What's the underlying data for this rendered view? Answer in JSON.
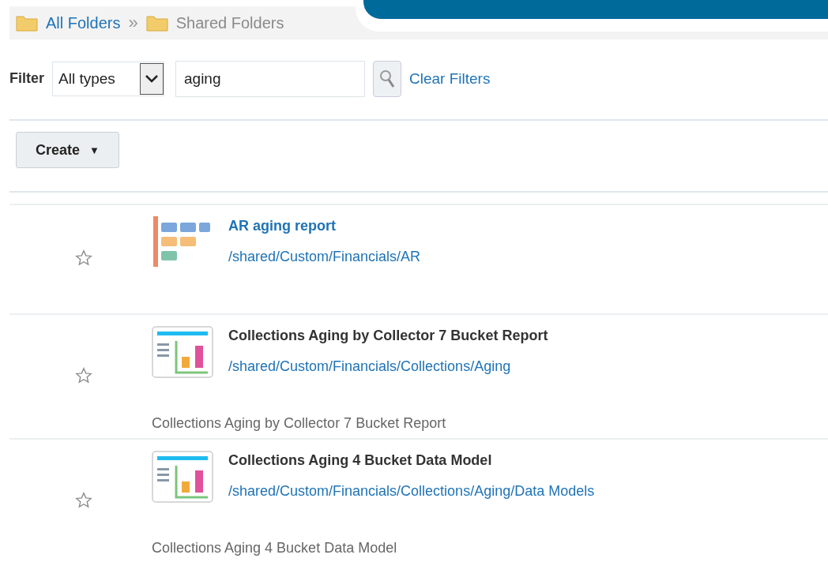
{
  "breadcrumb": [
    {
      "label": "All Folders",
      "current": false
    },
    {
      "separator": "»",
      "label": "Shared Folders",
      "current": true
    }
  ],
  "filter": {
    "label": "Filter",
    "type_value": "All types",
    "search_value": "aging",
    "clear_label": "Clear Filters"
  },
  "create_button": {
    "label": "Create",
    "caret": "▼"
  },
  "items": [
    {
      "kind": "report",
      "title": "AR aging report",
      "selected": true,
      "favorite": false,
      "path": "/shared/Custom/Financials/AR"
    },
    {
      "kind": "analysis",
      "title": "Collections Aging by Collector 7 Bucket Report",
      "selected": false,
      "favorite": false,
      "path": "/shared/Custom/Financials/Collections/Aging",
      "description": "Collections Aging by Collector 7 Bucket Report"
    },
    {
      "kind": "analysis",
      "title": "Collections Aging 4 Bucket Data Model",
      "selected": false,
      "favorite": false,
      "path": "/shared/Custom/Financials/Collections/Aging/Data Models",
      "description": "Collections Aging 4 Bucket Data Model"
    }
  ]
}
